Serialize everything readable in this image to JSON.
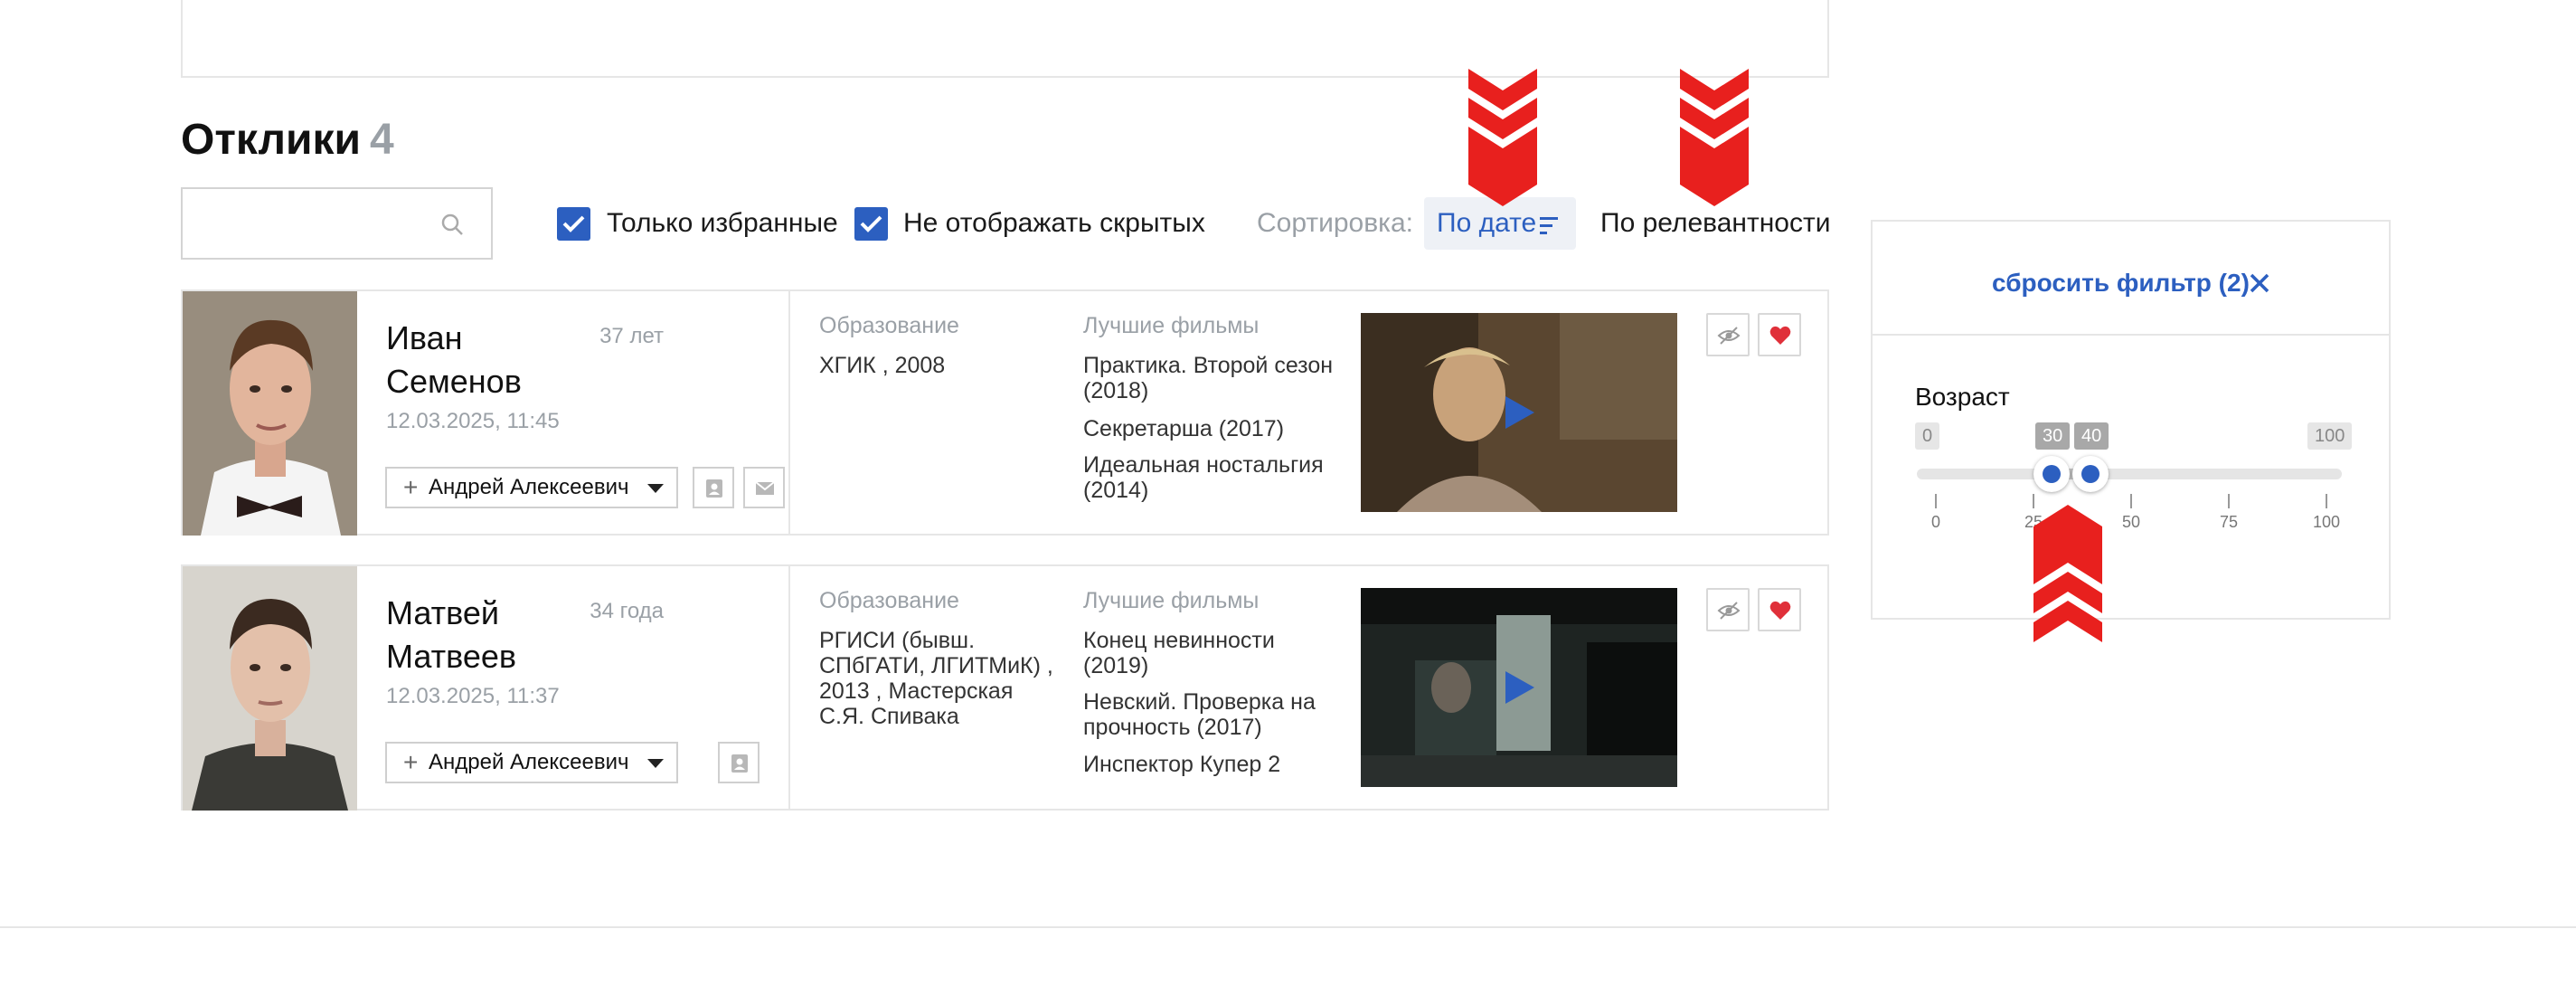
{
  "heading": {
    "title": "Отклики",
    "count": "4"
  },
  "search": {
    "placeholder": "",
    "value": ""
  },
  "filters": {
    "favorites_only": {
      "label": "Только избранные",
      "checked": true
    },
    "hide_hidden": {
      "label": "Не отображать скрытых",
      "checked": true
    }
  },
  "sort": {
    "label": "Сортировка:",
    "active": "По дате",
    "alternative": "По релевантности"
  },
  "responses": [
    {
      "first_name": "Иван",
      "last_name": "Семенов",
      "age": "37 лет",
      "date": "12.03.2025, 11:45",
      "assignee": "Андрей Алексеевич",
      "education_title": "Образование",
      "education": "ХГИК , 2008",
      "films_title": "Лучшие фильмы",
      "films": [
        "Практика. Второй сезон (2018)",
        "Секретарша (2017)",
        "Идеальная ностальгия (2014)"
      ]
    },
    {
      "first_name": "Матвей",
      "last_name": "Матвеев",
      "age": "34 года",
      "date": "12.03.2025, 11:37",
      "assignee": "Андрей Алексеевич",
      "education_title": "Образование",
      "education": "РГИСИ (бывш. СПбГАТИ, ЛГИТМиК) , 2013 , Мастерская С.Я. Спивака",
      "films_title": "Лучшие фильмы",
      "films": [
        "Конец невинности (2019)",
        "Невский. Проверка на прочность (2017)",
        "Инспектор Купер 2"
      ]
    }
  ],
  "filter_panel": {
    "reset_label": "сбросить фильтр (2)",
    "age_title": "Возраст",
    "range_min": "0",
    "range_max": "100",
    "selected_from": "30",
    "selected_to": "40",
    "ticks": [
      "0",
      "25",
      "50",
      "75",
      "100"
    ]
  },
  "colors": {
    "accent": "#2c5fc0",
    "favorite": "#e0303a",
    "marker": "#e8201e"
  }
}
